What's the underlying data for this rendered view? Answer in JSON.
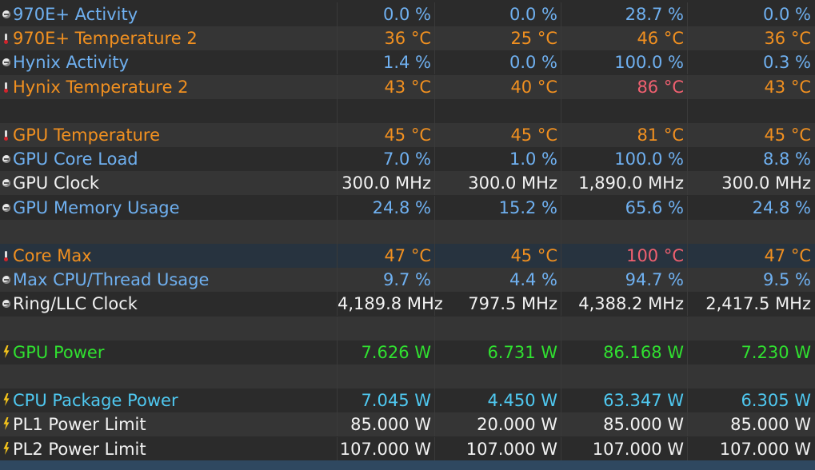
{
  "rows": [
    {
      "label": "970E+ Activity",
      "icon": "usage-icon",
      "color": "blue",
      "values": [
        "0.0 %",
        "0.0 %",
        "28.7 %",
        "0.0 %"
      ]
    },
    {
      "label": "970E+ Temperature 2",
      "icon": "thermometer-icon",
      "color": "orange",
      "values": [
        "36 °C",
        "25 °C",
        "46 °C",
        "36 °C"
      ]
    },
    {
      "label": "Hynix Activity",
      "icon": "usage-icon",
      "color": "blue",
      "values": [
        "1.4 %",
        "0.0 %",
        "100.0 %",
        "0.3 %"
      ]
    },
    {
      "label": "Hynix Temperature 2",
      "icon": "thermometer-icon",
      "color": "orange",
      "values": [
        "43 °C",
        "40 °C",
        "86 °C",
        "43 °C"
      ],
      "max_color": "red"
    },
    {
      "spacer": true
    },
    {
      "label": "GPU Temperature",
      "icon": "thermometer-icon",
      "color": "orange",
      "values": [
        "45 °C",
        "45 °C",
        "81 °C",
        "45 °C"
      ]
    },
    {
      "label": "GPU Core Load",
      "icon": "usage-icon",
      "color": "blue",
      "values": [
        "7.0 %",
        "1.0 %",
        "100.0 %",
        "8.8 %"
      ]
    },
    {
      "label": "GPU Clock",
      "icon": "clock-icon",
      "color": "white",
      "values": [
        "300.0 MHz",
        "300.0 MHz",
        "1,890.0 MHz",
        "300.0 MHz"
      ]
    },
    {
      "label": "GPU Memory Usage",
      "icon": "usage-icon",
      "color": "blue",
      "values": [
        "24.8 %",
        "15.2 %",
        "65.6 %",
        "24.8 %"
      ]
    },
    {
      "spacer": true
    },
    {
      "label": "Core Max",
      "icon": "thermometer-icon",
      "color": "orange",
      "values": [
        "47 °C",
        "45 °C",
        "100 °C",
        "47 °C"
      ],
      "max_color": "red",
      "selected": true
    },
    {
      "label": "Max CPU/Thread Usage",
      "icon": "usage-icon",
      "color": "blue",
      "values": [
        "9.7 %",
        "4.4 %",
        "94.7 %",
        "9.5 %"
      ]
    },
    {
      "label": "Ring/LLC Clock",
      "icon": "clock-icon",
      "color": "white",
      "values": [
        "4,189.8 MHz",
        "797.5 MHz",
        "4,388.2 MHz",
        "2,417.5 MHz"
      ]
    },
    {
      "spacer": true
    },
    {
      "label": "GPU Power",
      "icon": "power-icon",
      "color": "green",
      "values": [
        "7.626 W",
        "6.731 W",
        "86.168 W",
        "7.230 W"
      ]
    },
    {
      "spacer": true
    },
    {
      "label": "CPU Package Power",
      "icon": "power-icon",
      "color": "cyan",
      "values": [
        "7.045 W",
        "4.450 W",
        "63.347 W",
        "6.305 W"
      ]
    },
    {
      "label": "PL1 Power Limit",
      "icon": "power-icon",
      "color": "white",
      "values": [
        "85.000 W",
        "20.000 W",
        "85.000 W",
        "85.000 W"
      ]
    },
    {
      "label": "PL2 Power Limit",
      "icon": "power-icon",
      "color": "white",
      "values": [
        "107.000 W",
        "107.000 W",
        "107.000 W",
        "107.000 W"
      ]
    }
  ],
  "colors": {
    "white": "#f2f2f2",
    "blue": "#6fb0f0",
    "orange": "#f19020",
    "green": "#30e030",
    "cyan": "#4fc8f0",
    "red": "#f06070"
  }
}
